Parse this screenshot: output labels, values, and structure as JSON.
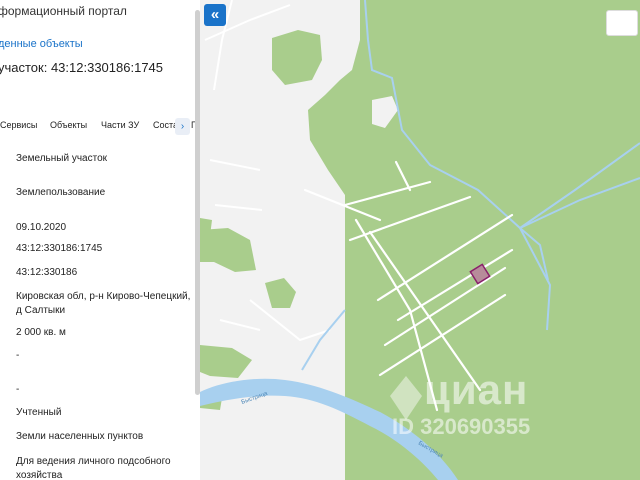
{
  "panel": {
    "portal_title": "формационный портал",
    "found_link": "денные объекты",
    "parcel_title": "участок: 43:12:330186:1745",
    "tabs": [
      "Сервисы",
      "Объекты",
      "Части ЗУ",
      "Соста"
    ],
    "tab_arrow": "›",
    "tab_overflow": "Г",
    "properties": [
      "Земельный участок",
      "Землепользование",
      "09.10.2020",
      "43:12:330186:1745",
      "43:12:330186",
      "Кировская обл, р-н Кирово-Чепецкий, д Салтыки",
      "2 000 кв. м",
      "-",
      "-",
      "Учтенный",
      "Земли населенных пунктов",
      "Для ведения личного подсобного хозяйства"
    ]
  },
  "map": {
    "collapse_icon": "«",
    "river_label": "Быстрица",
    "watermark_brand": "циан",
    "watermark_id": "ID 320690355",
    "colors": {
      "forest": "#a9cd8c",
      "land": "#f2f2f2",
      "water": "#a8d0ef",
      "road": "#ffffff",
      "parcel_fill": "#b78c9a",
      "parcel_stroke": "#8a1f6b",
      "link": "#1a73c9"
    }
  }
}
